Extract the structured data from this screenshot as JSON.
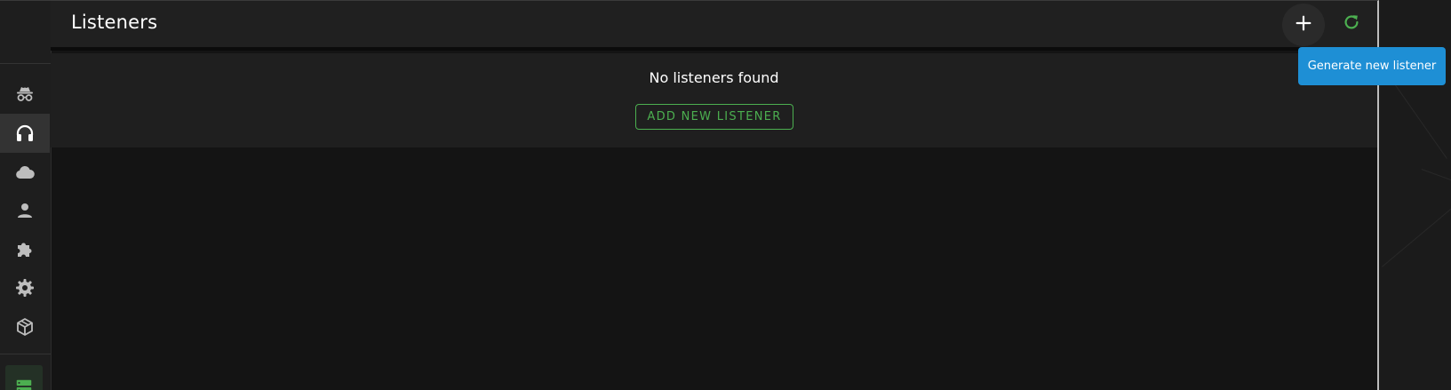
{
  "header": {
    "title": "Listeners",
    "add_icon": "plus-icon",
    "refresh_icon": "refresh-icon"
  },
  "tooltip": {
    "text": "Generate new listener"
  },
  "main": {
    "empty_message": "No listeners found",
    "add_button_label": "ADD NEW LISTENER"
  },
  "sidebar": {
    "items": [
      {
        "icon": "incognito-icon",
        "active": false
      },
      {
        "icon": "headphones-icon",
        "active": true
      },
      {
        "icon": "cloud-icon",
        "active": false
      },
      {
        "icon": "user-icon",
        "active": false
      },
      {
        "icon": "puzzle-icon",
        "active": false
      },
      {
        "icon": "gear-icon",
        "active": false
      },
      {
        "icon": "package-icon",
        "active": false
      }
    ],
    "bottom_icon": "server-icon"
  },
  "colors": {
    "accent_green": "#4caf50",
    "tooltip_blue": "#1e8fd5",
    "sidebar_bg": "#1e1e1e",
    "content_bg": "#141414"
  }
}
